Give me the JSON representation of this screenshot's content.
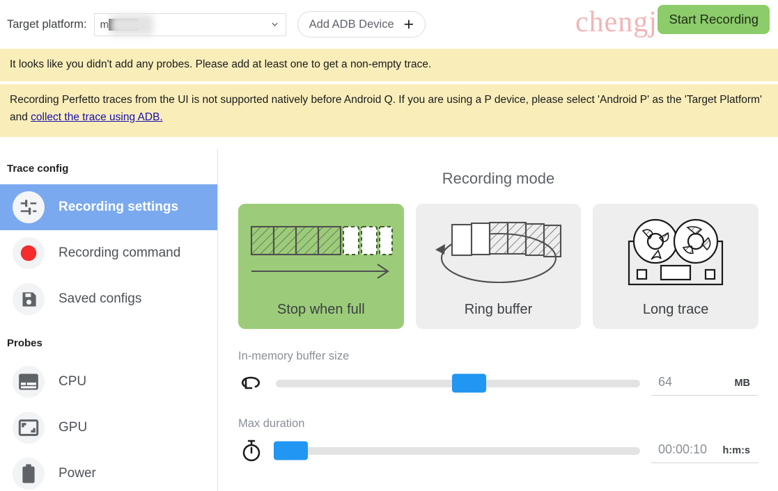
{
  "watermark": "chengjin.com",
  "topbar": {
    "target_platform_label": "Target platform:",
    "target_platform_value": "m████.",
    "add_adb_label": "Add ADB Device",
    "add_adb_plus": "+",
    "start_recording_label": "Start Recording",
    "start_recording_color": "#8ccc6b"
  },
  "banners": [
    {
      "text": "It looks like you didn't add any probes. Please add at least one to get a non-empty trace.",
      "bg": "#f9eeba"
    },
    {
      "text_before": "Recording Perfetto traces from the UI is not supported natively before Android Q. If you are using a P device, please select 'Android P' as the 'Target Platform' and ",
      "link_text": "collect the trace using ADB.",
      "link_color": "#1a0dab",
      "bg": "#f9eeba"
    }
  ],
  "sidebar": {
    "sections": [
      {
        "title": "Trace config",
        "items": [
          {
            "label": "Recording settings",
            "icon": "tune-icon",
            "active": true
          },
          {
            "label": "Recording command",
            "icon": "record-circle-icon",
            "active": false
          },
          {
            "label": "Saved configs",
            "icon": "save-floppy-icon",
            "active": false
          }
        ]
      },
      {
        "title": "Probes",
        "items": [
          {
            "label": "CPU",
            "icon": "cpu-chip-icon",
            "active": false
          },
          {
            "label": "GPU",
            "icon": "gpu-frame-icon",
            "active": false
          },
          {
            "label": "Power",
            "icon": "battery-icon",
            "active": false
          }
        ]
      }
    ],
    "active_highlight_color": "#7aa9f0"
  },
  "main": {
    "recording_mode_title": "Recording mode",
    "modes": [
      {
        "label": "Stop when full",
        "icon": "linear-buffer-icon",
        "selected": true
      },
      {
        "label": "Ring buffer",
        "icon": "ring-buffer-icon",
        "selected": false
      },
      {
        "label": "Long trace",
        "icon": "tape-reel-icon",
        "selected": false
      }
    ],
    "selected_mode_color": "#9ccc79",
    "sliders": [
      {
        "label": "In-memory buffer size",
        "icon": "loop-arrow-icon",
        "value": "64",
        "unit": "MB",
        "fill_percent": 53,
        "thumb_color": "#2196f3"
      },
      {
        "label": "Max duration",
        "icon": "stopwatch-icon",
        "value": "00:00:10",
        "unit": "h:m:s",
        "fill_percent": 4,
        "thumb_color": "#2196f3"
      }
    ]
  }
}
